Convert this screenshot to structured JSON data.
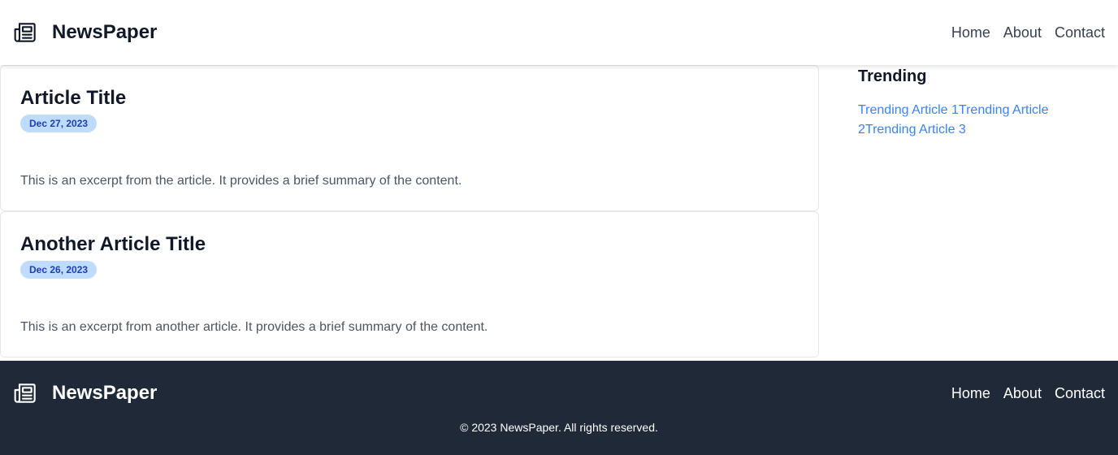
{
  "header": {
    "brand": "NewsPaper",
    "nav": [
      "Home",
      "About",
      "Contact"
    ]
  },
  "articles": [
    {
      "title": "Article Title",
      "date": "Dec 27, 2023",
      "excerpt": "This is an excerpt from the article. It provides a brief summary of the content."
    },
    {
      "title": "Another Article Title",
      "date": "Dec 26, 2023",
      "excerpt": "This is an excerpt from another article. It provides a brief summary of the content."
    }
  ],
  "sidebar": {
    "title": "Trending",
    "links": [
      "Trending Article 1",
      "Trending Article 2",
      "Trending Article 3"
    ]
  },
  "footer": {
    "brand": "NewsPaper",
    "nav": [
      "Home",
      "About",
      "Contact"
    ],
    "copyright": "© 2023 NewsPaper. All rights reserved."
  },
  "icons": {
    "logo": "newspaper-icon"
  },
  "colors": {
    "footer_bg": "#1f2937",
    "link": "#3b82f6",
    "badge_bg": "#bfdbfe",
    "badge_text": "#1e40af"
  }
}
